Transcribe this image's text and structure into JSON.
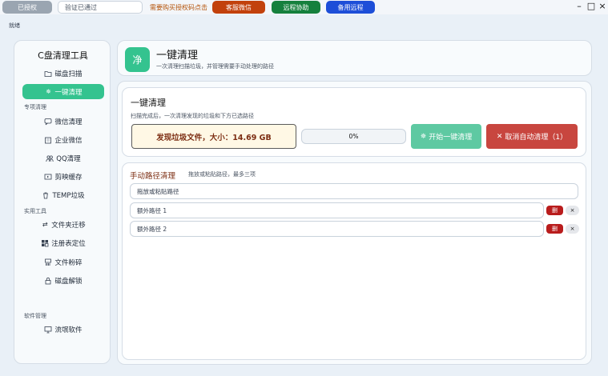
{
  "topbar": {
    "license_status": "已授权",
    "verify_status": "验证已通过",
    "buy_notice": "需要购买授权码点击",
    "btn_wechat_service": "客服微信",
    "btn_remote_assist": "远程协助",
    "btn_backup_remote": "备用远程",
    "colors": {
      "wechat": "#c2410c",
      "remote": "#15803d",
      "backup": "#1d4ed8"
    }
  },
  "status_text": "就绪",
  "sidebar": {
    "title": "C盘清理工具",
    "items_top": [
      {
        "label": "磁盘扫描",
        "icon": "folder-icon"
      },
      {
        "label": "一键清理",
        "icon": "gear-icon",
        "active": true
      }
    ],
    "group_special": "专项清理",
    "items_special": [
      {
        "label": "微信清理",
        "icon": "chat-icon"
      },
      {
        "label": "企业微信",
        "icon": "building-icon"
      },
      {
        "label": "QQ清理",
        "icon": "users-icon"
      },
      {
        "label": "剪映缓存",
        "icon": "video-icon"
      },
      {
        "label": "TEMP垃圾",
        "icon": "trash-icon"
      }
    ],
    "group_tools": "实用工具",
    "items_tools": [
      {
        "label": "文件夹迁移",
        "icon": "transfer-icon"
      },
      {
        "label": "注册表定位",
        "icon": "registry-icon"
      },
      {
        "label": "文件粉碎",
        "icon": "shredder-icon"
      },
      {
        "label": "磁盘解锁",
        "icon": "lock-icon"
      }
    ],
    "group_software": "软件管理",
    "items_software": [
      {
        "label": "流氓软件",
        "icon": "monitor-icon"
      }
    ],
    "accent": "#34c38f"
  },
  "header": {
    "icon_char": "净",
    "title": "一键清理",
    "subtitle": "一次清理扫描垃圾，并管理需要手动处理的路径"
  },
  "oneclick": {
    "title": "一键清理",
    "description": "扫描完成后，一次清理发现的垃圾和下方已选路径",
    "found_label": "发现垃圾文件，大小：14.69 GB",
    "progress_percent": 0,
    "progress_text": "0%",
    "start_button": "开始一键清理",
    "cancel_button": "取消自动清理（1）"
  },
  "manual": {
    "title": "手动路径清理",
    "hint": "拖放或粘贴路径，最多三项",
    "dropzone_placeholder": "拖放或粘贴路径",
    "paths": [
      {
        "placeholder": "额外路径 1",
        "delete_label": "删",
        "clear_label": "×"
      },
      {
        "placeholder": "额外路径 2",
        "delete_label": "删",
        "clear_label": "×"
      }
    ]
  }
}
